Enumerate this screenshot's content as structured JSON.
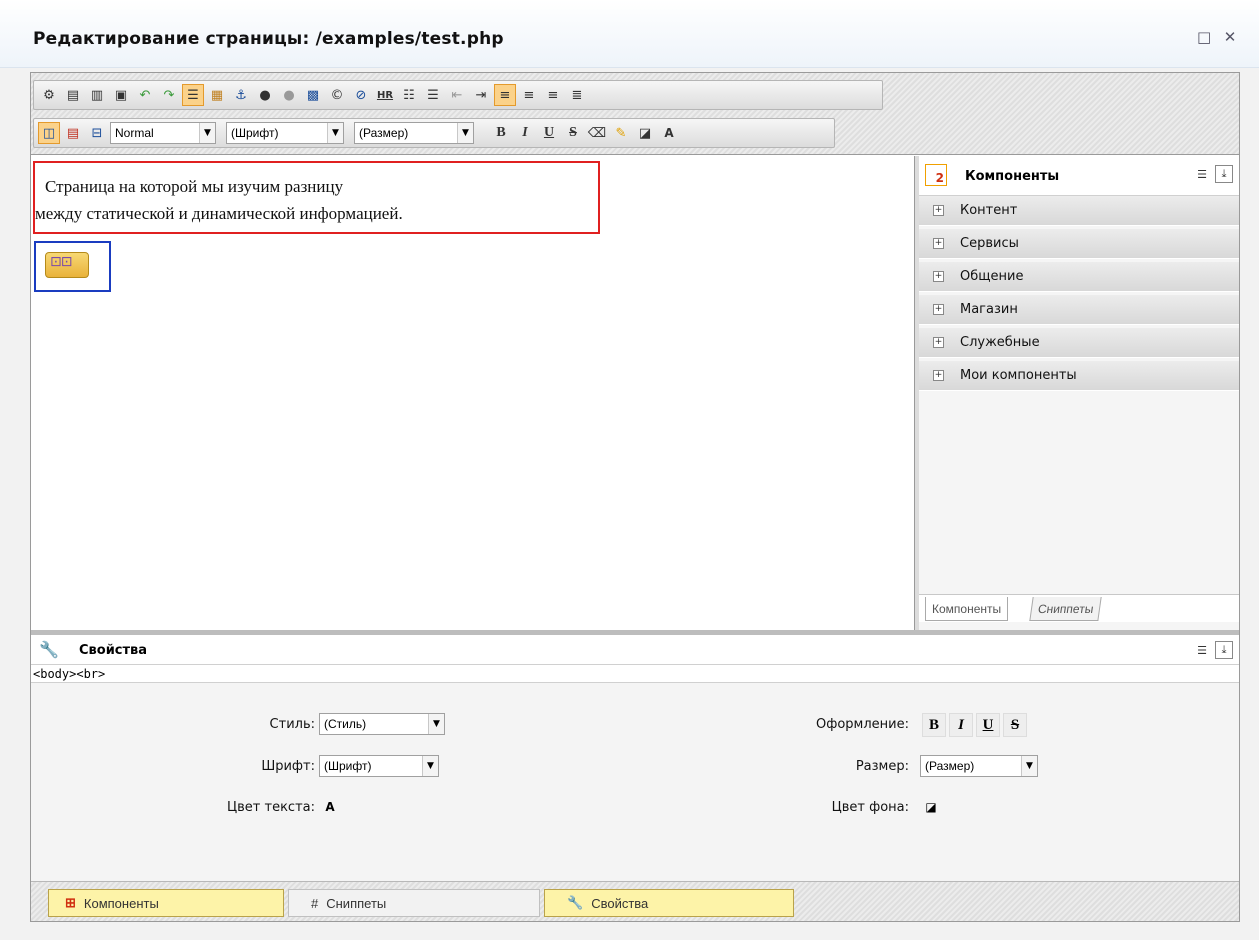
{
  "window": {
    "title": "Редактирование страницы: /examples/test.php",
    "restore_glyph": "□",
    "close_glyph": "✕"
  },
  "toolbar": {
    "style_select": "Normal",
    "font_select": "(Шрифт)",
    "size_select": "(Размер)",
    "bold": "B",
    "italic": "I",
    "underline": "U",
    "strike": "S",
    "hr_label": "HR",
    "row1_icons": [
      "settings-icon",
      "save-word-icon",
      "save-text-icon",
      "paste-icon",
      "undo-icon",
      "redo-icon",
      "select-all-icon",
      "table-icon",
      "anchor-icon",
      "link-icon",
      "unlink-icon",
      "image-icon",
      "copyright-icon",
      "flash-icon",
      "hr-icon",
      "ordered-list-icon",
      "bullet-list-icon",
      "outdent-icon",
      "indent-icon",
      "align-left-icon",
      "align-center-icon",
      "align-right-icon",
      "justify-icon"
    ],
    "row2_icons": [
      "wysiwyg-mode-icon",
      "code-mode-icon",
      "split-mode-icon"
    ]
  },
  "editor": {
    "text_line1": "Страница на которой мы изучим разницу",
    "text_line2": "между статической и динамической информацией."
  },
  "components_panel": {
    "title": "Компоненты",
    "categories": [
      "Контент",
      "Сервисы",
      "Общение",
      "Магазин",
      "Служебные",
      "Мои компоненты"
    ],
    "tab_components": "Компоненты",
    "tab_snippets": "Сниппеты"
  },
  "properties": {
    "title": "Свойства",
    "path": "<body><br>",
    "style_label": "Стиль:",
    "style_value": "(Стиль)",
    "font_label": "Шрифт:",
    "font_value": "(Шрифт)",
    "text_color_label": "Цвет текста:",
    "formatting_label": "Оформление:",
    "size_label": "Размер:",
    "size_value": "(Размер)",
    "bg_color_label": "Цвет фона:"
  },
  "bottom_tabs": {
    "components": "Компоненты",
    "snippets": "Сниппеты",
    "properties": "Свойства"
  },
  "colors": {
    "highlight_box": "#e02020",
    "component_box": "#1a3cc0",
    "active_button": "#fbd28a",
    "bottom_tab_active": "#fdf3a8"
  }
}
